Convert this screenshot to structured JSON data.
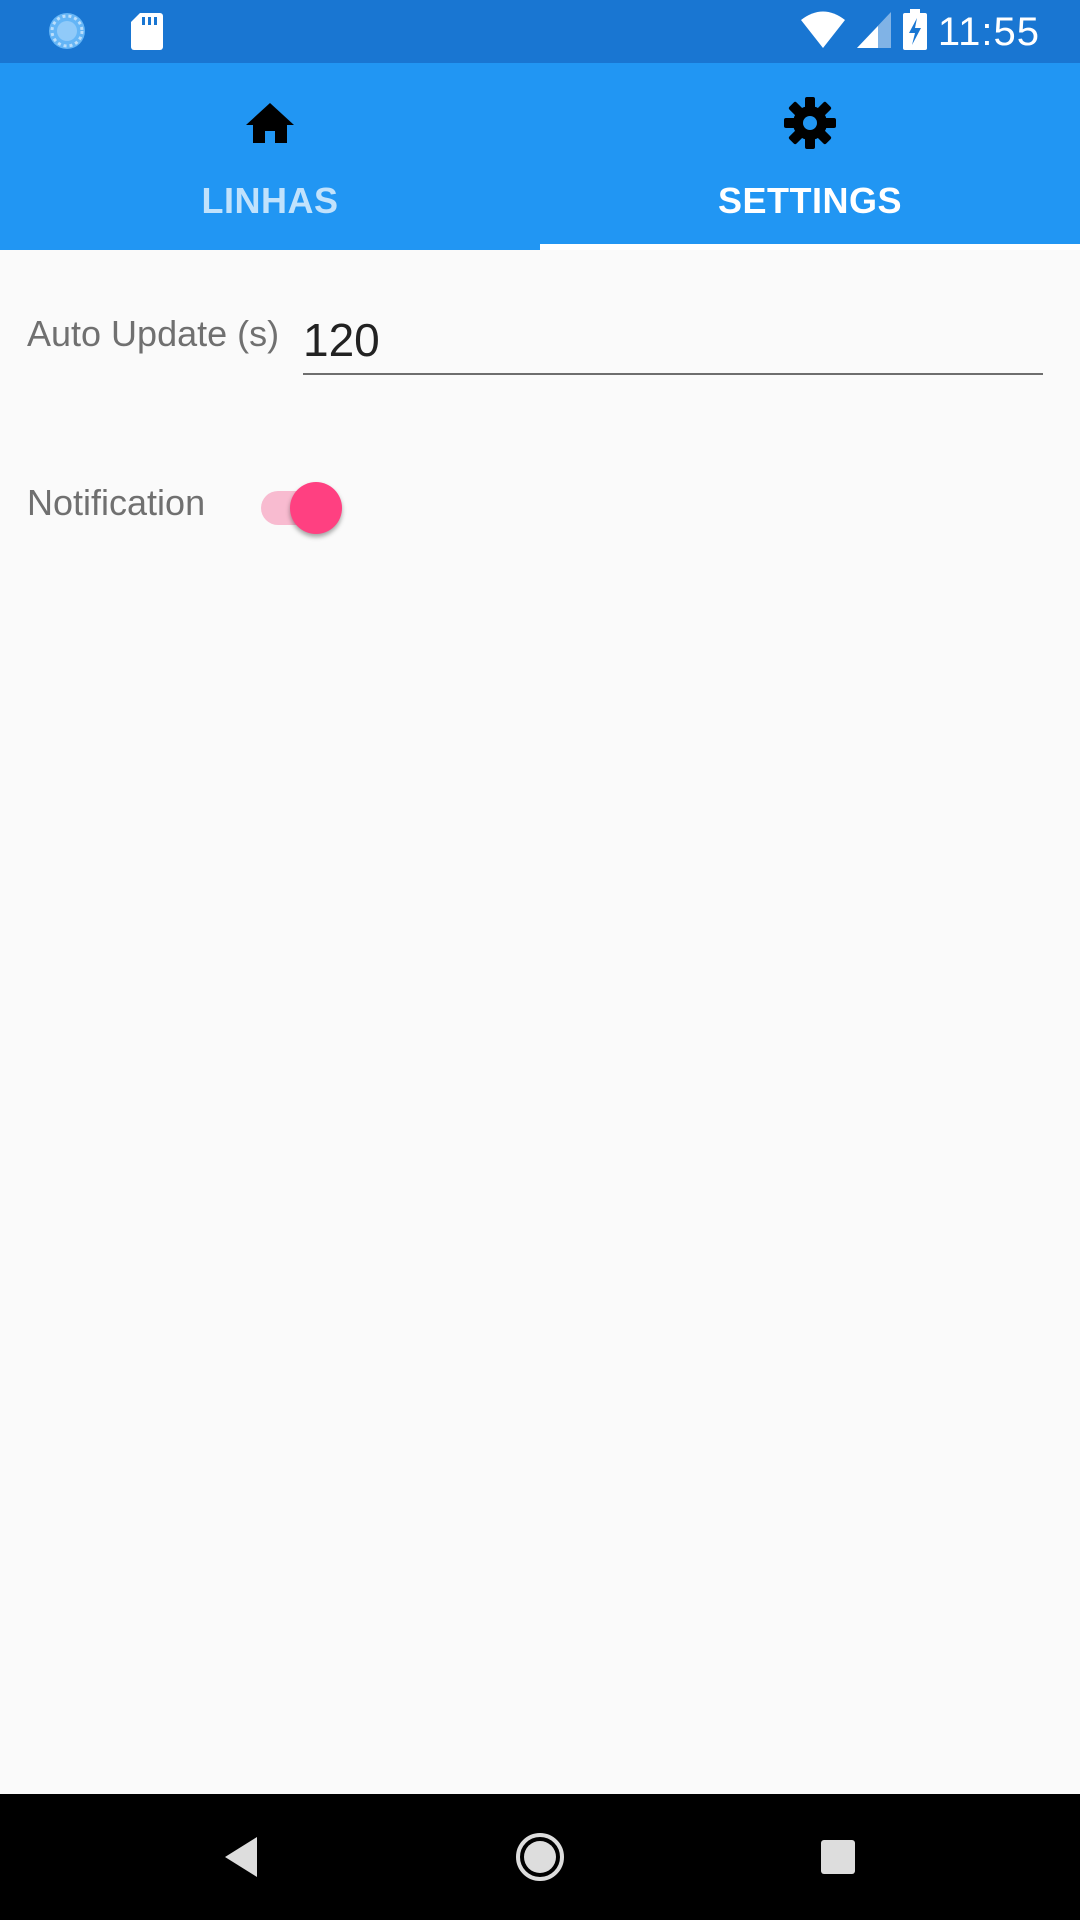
{
  "status_bar": {
    "time": "11:55",
    "icons": [
      "sync-icon",
      "sd-card-icon",
      "wifi-icon",
      "signal-icon",
      "battery-charging-icon"
    ]
  },
  "tabs": [
    {
      "label": "LINHAS",
      "icon": "home-icon",
      "active": false
    },
    {
      "label": "SETTINGS",
      "icon": "gear-icon",
      "active": true
    }
  ],
  "settings": {
    "auto_update": {
      "label": "Auto Update (s)",
      "value": "120"
    },
    "notification": {
      "label": "Notification",
      "enabled": true
    }
  },
  "nav_bar": {
    "buttons": [
      "back-icon",
      "home-circle-icon",
      "recents-icon"
    ]
  },
  "colors": {
    "status_bar": "#1976D2",
    "tab_bar": "#2196F3",
    "accent": "#FF4081",
    "background": "#FAFAFA"
  }
}
